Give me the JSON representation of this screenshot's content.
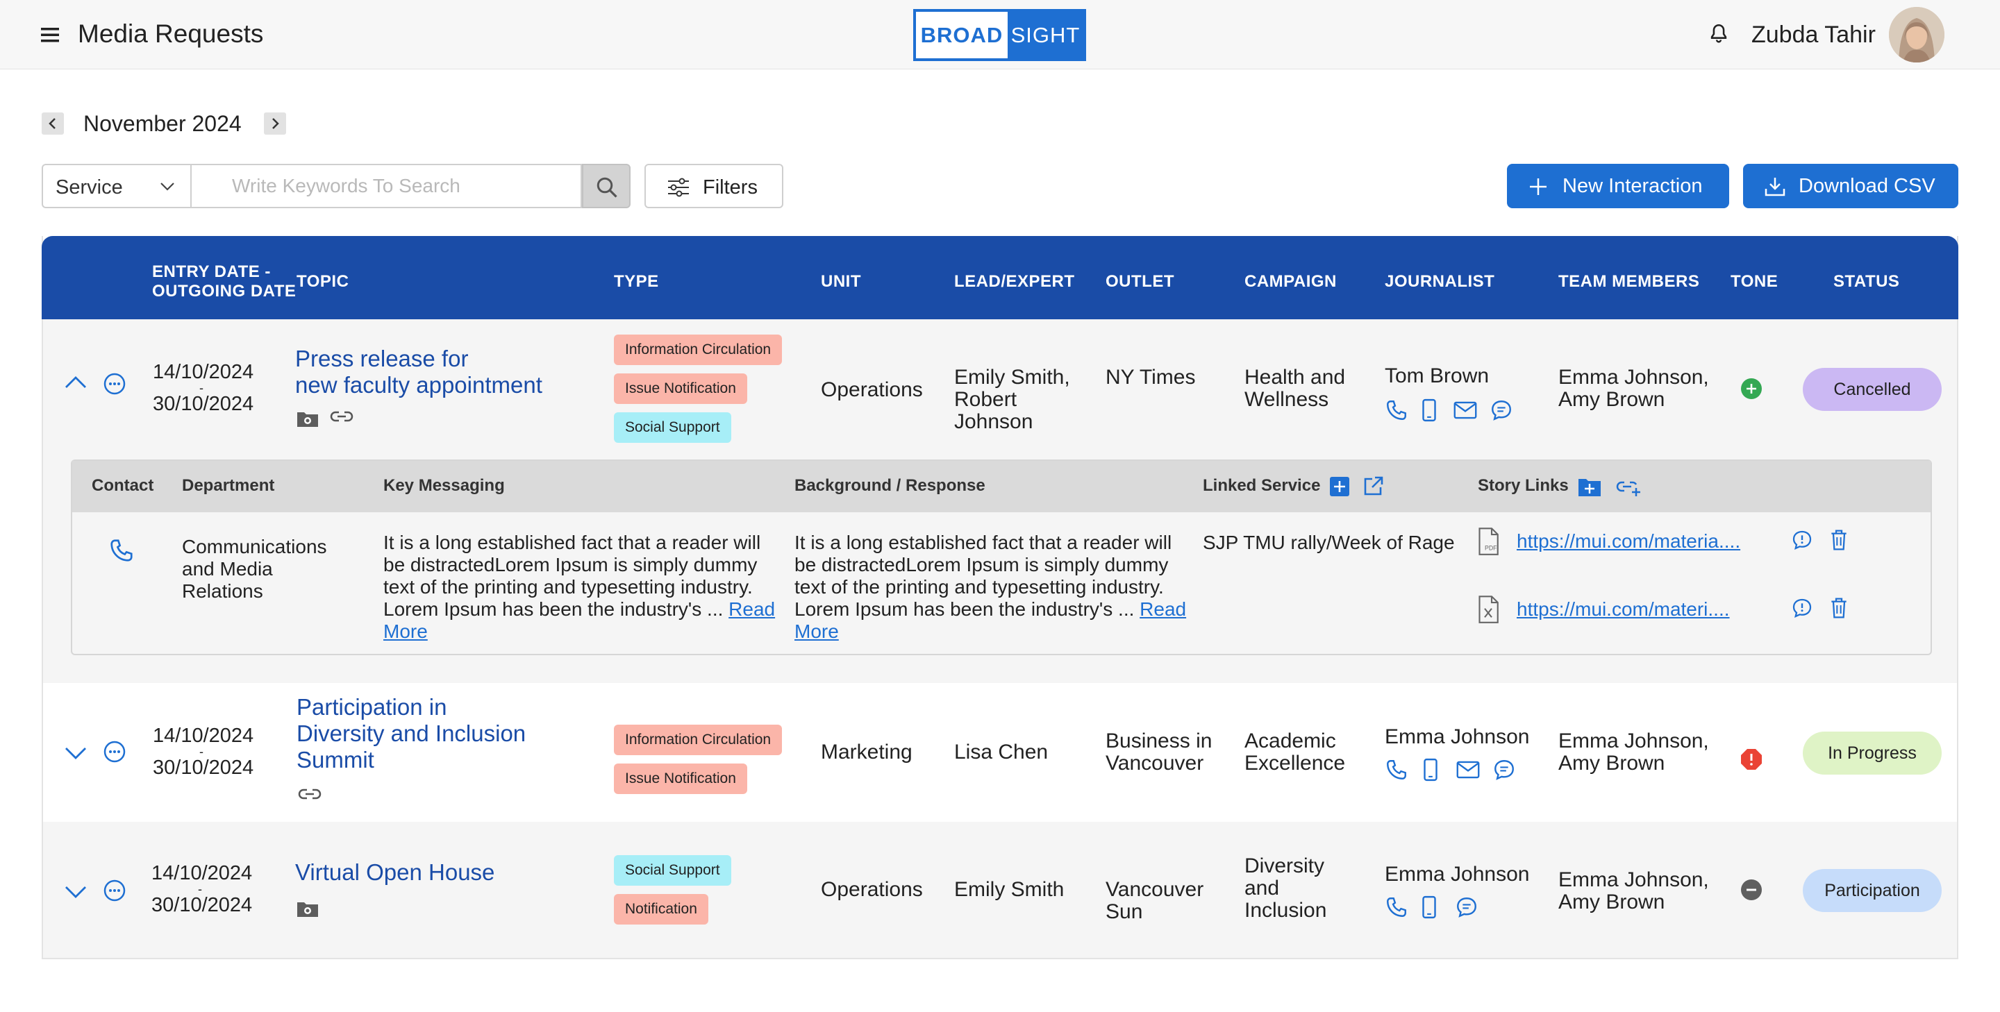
{
  "header": {
    "title": "Media Requests",
    "logo_left": "BROAD",
    "logo_right": "SIGHT",
    "user_name": "Zubda Tahir"
  },
  "month": {
    "label": "November 2024"
  },
  "search": {
    "service_label": "Service",
    "placeholder": "Write Keywords To Search"
  },
  "toolbar": {
    "filters_label": "Filters",
    "new_label": "New Interaction",
    "csv_label": "Download CSV"
  },
  "colors": {
    "primary": "#1e6fd2",
    "header_blue": "#1a4ca7",
    "chip_red": "#fbb5a9",
    "chip_cyan": "#a7eef7",
    "cancelled": "#cbb8f3",
    "in_progress": "#dff3c6",
    "participation": "#c6dcfa",
    "tone_positive": "#34a853",
    "tone_negative": "#ea4335",
    "tone_neutral": "#5f5f5f"
  },
  "columns": {
    "entry_date": "ENTRY DATE -",
    "outgoing_date": "OUTGOING DATE",
    "topic": "TOPIC",
    "type": "TYPE",
    "unit": "UNIT",
    "lead": "LEAD/EXPERT",
    "outlet": "OUTLET",
    "campaign": "CAMPAIGN",
    "journalist": "JOURNALIST",
    "team": "TEAM MEMBERS",
    "tone": "TONE",
    "status": "STATUS"
  },
  "rows": [
    {
      "entry_date": "14/10/2024",
      "outgoing_date": "30/10/2024",
      "sep": "-",
      "topic_line1": "Press release for",
      "topic_line2": "new faculty appointment",
      "types": [
        "Information Circulation",
        "Issue Notification",
        "Social Support"
      ],
      "unit": "Operations",
      "lead_line1": "Emily Smith,",
      "lead_line2": "Robert",
      "lead_line3": "Johnson",
      "outlet": "NY Times",
      "campaign_line1": "Health and",
      "campaign_line2": "Wellness",
      "journalist": "Tom Brown",
      "team_line1": "Emma Johnson,",
      "team_line2": "Amy Brown",
      "tone": "positive",
      "status": "Cancelled",
      "expanded": true,
      "detail": {
        "headers": {
          "contact": "Contact",
          "department": "Department",
          "key": "Key Messaging",
          "background": "Background / Response",
          "linked": "Linked Service",
          "story": "Story Links"
        },
        "department_line1": "Communications",
        "department_line2": "and Media",
        "department_line3": "Relations",
        "key_text": "It is a long established fact that a reader will be distractedLorem Ipsum is simply dummy text of the printing and typesetting industry. Lorem Ipsum has been the industry's ...",
        "background_text": "It is a long established fact that a reader will be distractedLorem Ipsum is simply dummy text of the printing and typesetting industry. Lorem Ipsum has been the industry's ...",
        "read_more": "Read More",
        "linked_service": "SJP TMU rally/Week of Rage",
        "story_links": [
          "https://mui.com/materia....",
          "https://mui.com/materi...."
        ]
      }
    },
    {
      "entry_date": "14/10/2024",
      "outgoing_date": "30/10/2024",
      "sep": "-",
      "topic_line1": "Participation in",
      "topic_line2": "Diversity and Inclusion",
      "topic_line3": "Summit",
      "types": [
        "Information Circulation",
        "Issue Notification"
      ],
      "unit": "Marketing",
      "lead_line1": "Lisa Chen",
      "outlet_line1": "Business in",
      "outlet_line2": "Vancouver",
      "campaign_line1": "Academic",
      "campaign_line2": "Excellence",
      "journalist": "Emma Johnson",
      "team_line1": "Emma Johnson,",
      "team_line2": "Amy Brown",
      "tone": "negative",
      "status": "In Progress"
    },
    {
      "entry_date": "14/10/2024",
      "outgoing_date": "30/10/2024",
      "sep": "-",
      "topic_line1": "Virtual Open House",
      "types": [
        "Social Support",
        "Notification"
      ],
      "unit": "Operations",
      "lead_line1": "Emily Smith",
      "outlet_line1": "Vancouver",
      "outlet_line2": "Sun",
      "campaign_line1": "Diversity",
      "campaign_line2": "and",
      "campaign_line3": "Inclusion",
      "journalist": "Emma Johnson",
      "team_line1": "Emma Johnson,",
      "team_line2": "Amy Brown",
      "tone": "neutral",
      "status": "Participation"
    }
  ]
}
